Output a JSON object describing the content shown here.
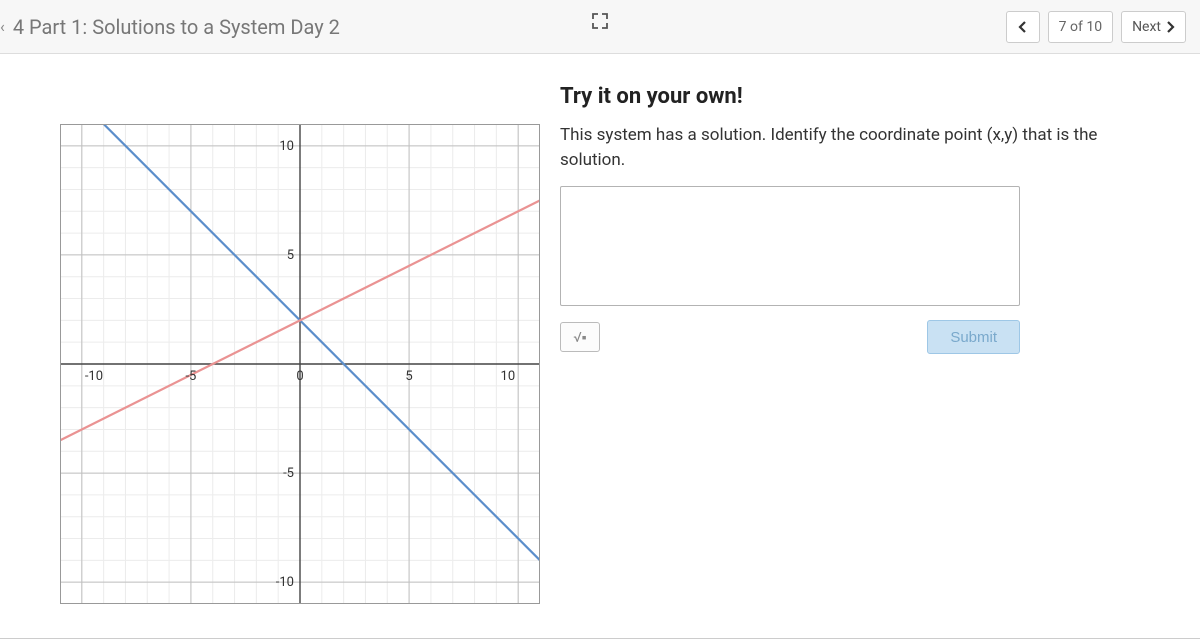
{
  "header": {
    "title": "4 Part 1: Solutions to a System Day 2",
    "page_indicator": "7 of 10",
    "next_label": "Next"
  },
  "question": {
    "heading": "Try it on your own!",
    "prompt": "This system has a solution. Identify the coordinate point (x,y) that is the solution.",
    "answer_value": "",
    "submit_label": "Submit",
    "math_toggle_label": "√▪"
  },
  "chart_data": {
    "type": "line",
    "title": "",
    "xlabel": "",
    "ylabel": "",
    "xlim": [
      -11,
      11
    ],
    "ylim": [
      -11,
      11
    ],
    "x_ticks": [
      -10,
      -5,
      0,
      5,
      10
    ],
    "y_ticks": [
      -10,
      -5,
      0,
      5,
      10
    ],
    "grid": true,
    "series": [
      {
        "name": "blue-line",
        "color": "#5b8ecb",
        "equation": "y = -x + 2",
        "points": [
          [
            -9,
            11
          ],
          [
            11,
            -9
          ]
        ]
      },
      {
        "name": "red-line",
        "color": "#ea9393",
        "equation": "y = 0.5*x + 2",
        "points": [
          [
            -11,
            -3.5
          ],
          [
            11,
            7.5
          ]
        ]
      }
    ],
    "solution_point": [
      0,
      2
    ]
  }
}
